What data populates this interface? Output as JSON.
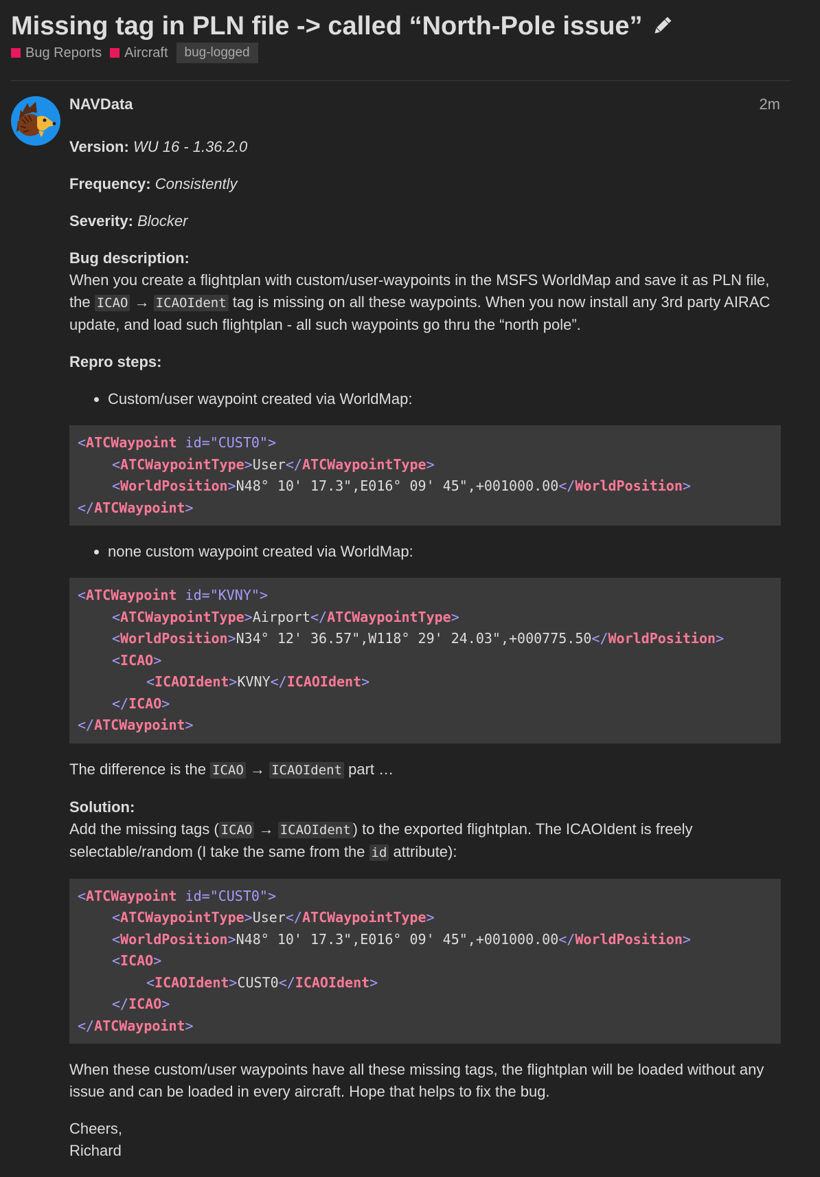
{
  "topic": {
    "title": "Missing tag in PLN file -> called “North-Pole issue”",
    "categories": [
      "Bug Reports",
      "Aircraft"
    ],
    "tag": "bug-logged",
    "category_color": "#e8195a"
  },
  "post": {
    "username": "NAVData",
    "time": "2m",
    "version_label": "Version:",
    "version_value": "WU 16 - 1.36.2.0",
    "frequency_label": "Frequency:",
    "frequency_value": "Consistently",
    "severity_label": "Severity:",
    "severity_value": "Blocker",
    "bug_label": "Bug description:",
    "bug_p1": "When you create a flightplan with custom/user-waypoints in the MSFS WorldMap and save it as PLN file, the ",
    "bug_code1": "ICAO",
    "arrow": "→",
    "bug_code2": "ICAOIdent",
    "bug_p2": " tag is missing on all these waypoints. When you now install any 3rd party AIRAC update, and load such flightplan - all such waypoints go thru the “north pole”.",
    "repro_label": "Repro steps:",
    "bullet1": "Custom/user waypoint created via WorldMap:",
    "bullet2": "none custom waypoint created via WorldMap:",
    "diff_before": "The difference is the ",
    "diff_code1": "ICAO",
    "diff_code2": "ICAOIdent",
    "diff_after": " part …",
    "solution_label": "Solution:",
    "sol_p1": "Add the missing tags (",
    "sol_code1": "ICAO",
    "sol_code2": "ICAOIdent",
    "sol_p2": ") to the exported flightplan. The ICAOIdent is freely selectable/random (I take the same from the ",
    "sol_code3": "id",
    "sol_p3": " attribute):",
    "closing": "When these custom/user waypoints have all these missing tags, the flightplan will be loaded without any issue and can be loaded in every aircraft. Hope that helps to fix the bug.",
    "cheers": "Cheers,",
    "signature": "Richard"
  },
  "code1": {
    "id": "\"CUST0\"",
    "type": "User",
    "pos": "N48° 10' 17.3\",E016° 09' 45\",+001000.00"
  },
  "code2": {
    "id": "\"KVNY\"",
    "type": "Airport",
    "pos": "N34° 12' 36.57\",W118° 29' 24.03\",+000775.50",
    "ident": "KVNY"
  },
  "code3": {
    "id": "\"CUST0\"",
    "type": "User",
    "pos": "N48° 10' 17.3\",E016° 09' 45\",+001000.00",
    "ident": "CUST0"
  },
  "xml": {
    "wp": "ATCWaypoint",
    "id_attr": "id",
    "type": "ATCWaypointType",
    "pos": "WorldPosition",
    "icao": "ICAO",
    "ident": "ICAOIdent"
  }
}
